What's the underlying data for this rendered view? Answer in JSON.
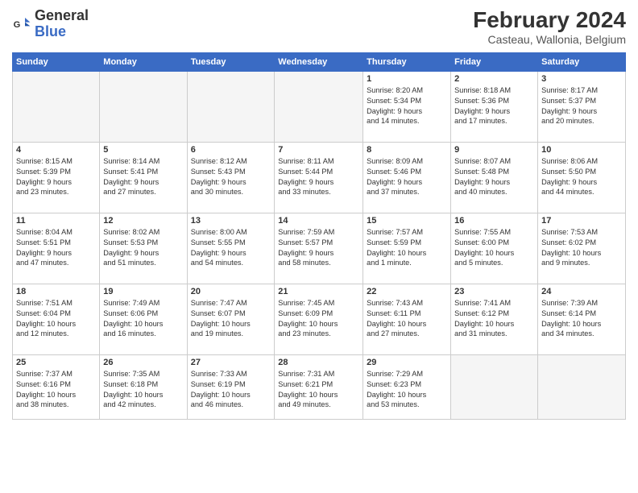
{
  "header": {
    "logo_line1": "General",
    "logo_line2": "Blue",
    "title": "February 2024",
    "subtitle": "Casteau, Wallonia, Belgium"
  },
  "days_of_week": [
    "Sunday",
    "Monday",
    "Tuesday",
    "Wednesday",
    "Thursday",
    "Friday",
    "Saturday"
  ],
  "weeks": [
    [
      {
        "num": "",
        "info": ""
      },
      {
        "num": "",
        "info": ""
      },
      {
        "num": "",
        "info": ""
      },
      {
        "num": "",
        "info": ""
      },
      {
        "num": "1",
        "info": "Sunrise: 8:20 AM\nSunset: 5:34 PM\nDaylight: 9 hours\nand 14 minutes."
      },
      {
        "num": "2",
        "info": "Sunrise: 8:18 AM\nSunset: 5:36 PM\nDaylight: 9 hours\nand 17 minutes."
      },
      {
        "num": "3",
        "info": "Sunrise: 8:17 AM\nSunset: 5:37 PM\nDaylight: 9 hours\nand 20 minutes."
      }
    ],
    [
      {
        "num": "4",
        "info": "Sunrise: 8:15 AM\nSunset: 5:39 PM\nDaylight: 9 hours\nand 23 minutes."
      },
      {
        "num": "5",
        "info": "Sunrise: 8:14 AM\nSunset: 5:41 PM\nDaylight: 9 hours\nand 27 minutes."
      },
      {
        "num": "6",
        "info": "Sunrise: 8:12 AM\nSunset: 5:43 PM\nDaylight: 9 hours\nand 30 minutes."
      },
      {
        "num": "7",
        "info": "Sunrise: 8:11 AM\nSunset: 5:44 PM\nDaylight: 9 hours\nand 33 minutes."
      },
      {
        "num": "8",
        "info": "Sunrise: 8:09 AM\nSunset: 5:46 PM\nDaylight: 9 hours\nand 37 minutes."
      },
      {
        "num": "9",
        "info": "Sunrise: 8:07 AM\nSunset: 5:48 PM\nDaylight: 9 hours\nand 40 minutes."
      },
      {
        "num": "10",
        "info": "Sunrise: 8:06 AM\nSunset: 5:50 PM\nDaylight: 9 hours\nand 44 minutes."
      }
    ],
    [
      {
        "num": "11",
        "info": "Sunrise: 8:04 AM\nSunset: 5:51 PM\nDaylight: 9 hours\nand 47 minutes."
      },
      {
        "num": "12",
        "info": "Sunrise: 8:02 AM\nSunset: 5:53 PM\nDaylight: 9 hours\nand 51 minutes."
      },
      {
        "num": "13",
        "info": "Sunrise: 8:00 AM\nSunset: 5:55 PM\nDaylight: 9 hours\nand 54 minutes."
      },
      {
        "num": "14",
        "info": "Sunrise: 7:59 AM\nSunset: 5:57 PM\nDaylight: 9 hours\nand 58 minutes."
      },
      {
        "num": "15",
        "info": "Sunrise: 7:57 AM\nSunset: 5:59 PM\nDaylight: 10 hours\nand 1 minute."
      },
      {
        "num": "16",
        "info": "Sunrise: 7:55 AM\nSunset: 6:00 PM\nDaylight: 10 hours\nand 5 minutes."
      },
      {
        "num": "17",
        "info": "Sunrise: 7:53 AM\nSunset: 6:02 PM\nDaylight: 10 hours\nand 9 minutes."
      }
    ],
    [
      {
        "num": "18",
        "info": "Sunrise: 7:51 AM\nSunset: 6:04 PM\nDaylight: 10 hours\nand 12 minutes."
      },
      {
        "num": "19",
        "info": "Sunrise: 7:49 AM\nSunset: 6:06 PM\nDaylight: 10 hours\nand 16 minutes."
      },
      {
        "num": "20",
        "info": "Sunrise: 7:47 AM\nSunset: 6:07 PM\nDaylight: 10 hours\nand 19 minutes."
      },
      {
        "num": "21",
        "info": "Sunrise: 7:45 AM\nSunset: 6:09 PM\nDaylight: 10 hours\nand 23 minutes."
      },
      {
        "num": "22",
        "info": "Sunrise: 7:43 AM\nSunset: 6:11 PM\nDaylight: 10 hours\nand 27 minutes."
      },
      {
        "num": "23",
        "info": "Sunrise: 7:41 AM\nSunset: 6:12 PM\nDaylight: 10 hours\nand 31 minutes."
      },
      {
        "num": "24",
        "info": "Sunrise: 7:39 AM\nSunset: 6:14 PM\nDaylight: 10 hours\nand 34 minutes."
      }
    ],
    [
      {
        "num": "25",
        "info": "Sunrise: 7:37 AM\nSunset: 6:16 PM\nDaylight: 10 hours\nand 38 minutes."
      },
      {
        "num": "26",
        "info": "Sunrise: 7:35 AM\nSunset: 6:18 PM\nDaylight: 10 hours\nand 42 minutes."
      },
      {
        "num": "27",
        "info": "Sunrise: 7:33 AM\nSunset: 6:19 PM\nDaylight: 10 hours\nand 46 minutes."
      },
      {
        "num": "28",
        "info": "Sunrise: 7:31 AM\nSunset: 6:21 PM\nDaylight: 10 hours\nand 49 minutes."
      },
      {
        "num": "29",
        "info": "Sunrise: 7:29 AM\nSunset: 6:23 PM\nDaylight: 10 hours\nand 53 minutes."
      },
      {
        "num": "",
        "info": ""
      },
      {
        "num": "",
        "info": ""
      }
    ]
  ]
}
